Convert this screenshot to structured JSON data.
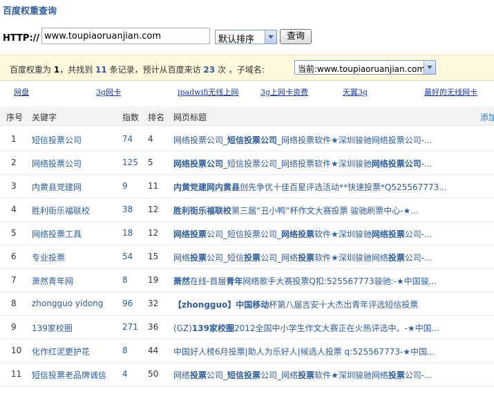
{
  "page": {
    "title": "百度权重查询"
  },
  "query": {
    "http_label": "HTTP://",
    "url_value": "www.toupiaoruanjian.com",
    "sort_selected": "默认排序",
    "submit_label": "查询"
  },
  "summary": {
    "p1": "百度权重为",
    "weight": "1",
    "p2": "，共找到",
    "records": "11",
    "p3": "条记录，预计从百度来访",
    "visits": "23",
    "p4": "次 ，子域名:",
    "subdomain_selected": "当前:www.toupiaoruanjian.com"
  },
  "links": [
    "网盘",
    "3g网卡",
    "ipadwifi无线上网",
    "3g上网卡资费",
    "天翼3g",
    "最好的无线网卡"
  ],
  "table": {
    "headers": {
      "index": "序号",
      "keyword": "关键字",
      "score": "指数",
      "rank": "排名",
      "title": "网页标题"
    },
    "add_link": "添加",
    "rows": [
      {
        "index": "1",
        "keyword": "短信投票公司",
        "score": "74",
        "rank": "4",
        "title": [
          [
            "网络投票公司_",
            false
          ],
          [
            "短信投票公司",
            true
          ],
          [
            "_网络投票软件★深圳骏驰网络投票公司-...",
            false
          ]
        ]
      },
      {
        "index": "2",
        "keyword": "网络投票公司",
        "score": "125",
        "rank": "5",
        "title": [
          [
            "网络投票公司",
            true
          ],
          [
            "_短信投票公司_网络投票软件★深圳骏驰",
            false
          ],
          [
            "网络投票公司",
            true
          ],
          [
            "-...",
            false
          ]
        ]
      },
      {
        "index": "3",
        "keyword": "内黄县党建网",
        "score": "9",
        "rank": "11",
        "title": [
          [
            "内黄党建网内黄县",
            true
          ],
          [
            "创先争优十佳百星评选活动**快速投票*Q525567773...",
            false
          ]
        ]
      },
      {
        "index": "4",
        "keyword": "胜利街乐福联校",
        "score": "38",
        "rank": "12",
        "title": [
          [
            "胜利街乐福联校",
            true
          ],
          [
            "第三届“丑小鸭”杯作文大赛投票  骏驰刷票中心-★...",
            false
          ]
        ]
      },
      {
        "index": "5",
        "keyword": "网络投票工具",
        "score": "18",
        "rank": "12",
        "title": [
          [
            "网络投票",
            true
          ],
          [
            "公司_短信投票公司_",
            false
          ],
          [
            "网络投票",
            true
          ],
          [
            "软件★深圳骏驰",
            false
          ],
          [
            "网络投票",
            true
          ],
          [
            "公司-...",
            false
          ]
        ]
      },
      {
        "index": "6",
        "keyword": "专业投票",
        "score": "54",
        "rank": "15",
        "title": [
          [
            "网络",
            false
          ],
          [
            "投票",
            true
          ],
          [
            "公司_短信",
            false
          ],
          [
            "投票",
            true
          ],
          [
            "公司_网络",
            false
          ],
          [
            "投票",
            true
          ],
          [
            "软件★深圳骏驰网络",
            false
          ],
          [
            "投票",
            true
          ],
          [
            "公司-...",
            false
          ]
        ]
      },
      {
        "index": "7",
        "keyword": "萧然青年网",
        "score": "8",
        "rank": "19",
        "title": [
          [
            "萧然",
            true
          ],
          [
            "在线-首届",
            false
          ],
          [
            "青年",
            true
          ],
          [
            "网络歌手大赛投票Q扣:525567773骏驰:-★中国骏...",
            false
          ]
        ]
      },
      {
        "index": "8",
        "keyword": "zhongguo yidong",
        "score": "96",
        "rank": "32",
        "title": [
          [
            "【zhongguo】中国移动",
            true
          ],
          [
            "杯第八届吉安十大杰出青年评选短信投票",
            false
          ]
        ]
      },
      {
        "index": "9",
        "keyword": "139家校圈",
        "score": "271",
        "rank": "36",
        "title": [
          [
            "(GZ)",
            false
          ],
          [
            "139家校圈",
            true
          ],
          [
            "2012全国中小学生作文大赛正在火热评选中。-★中国...",
            false
          ]
        ]
      },
      {
        "index": "10",
        "keyword": "化作红泥更护花",
        "score": "8",
        "rank": "44",
        "title": [
          [
            "中国好人榜6月投票|助人为乐好人|候选人投票  q:525567773-★中国...",
            false
          ]
        ]
      },
      {
        "index": "11",
        "keyword": "短信投票老品牌诚信",
        "score": "4",
        "rank": "50",
        "title": [
          [
            "网络",
            false
          ],
          [
            "投票",
            true
          ],
          [
            "公司_",
            false
          ],
          [
            "短信投票",
            true
          ],
          [
            "公司_网络",
            false
          ],
          [
            "投票",
            true
          ],
          [
            "软件★深圳骏驰网络",
            false
          ],
          [
            "投票",
            true
          ],
          [
            "公司-...",
            false
          ]
        ]
      }
    ]
  }
}
